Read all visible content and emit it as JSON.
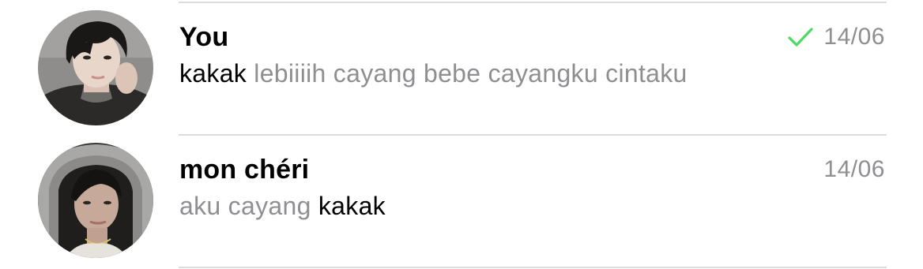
{
  "chats": [
    {
      "name": "You",
      "preview_highlight": "kakak",
      "preview_rest": " lebiiiih cayang bebe cayangku cintaku",
      "date": "14/06",
      "read_status_icon": "check-icon",
      "read_status_color": "#4cd964"
    },
    {
      "name": "mon chéri",
      "preview_rest": "aku cayang ",
      "preview_highlight": "kakak",
      "date": "14/06"
    }
  ],
  "colors": {
    "primary_text": "#000000",
    "secondary_text": "#8e8e93",
    "divider": "#dcdcdc",
    "check": "#4cd964"
  }
}
